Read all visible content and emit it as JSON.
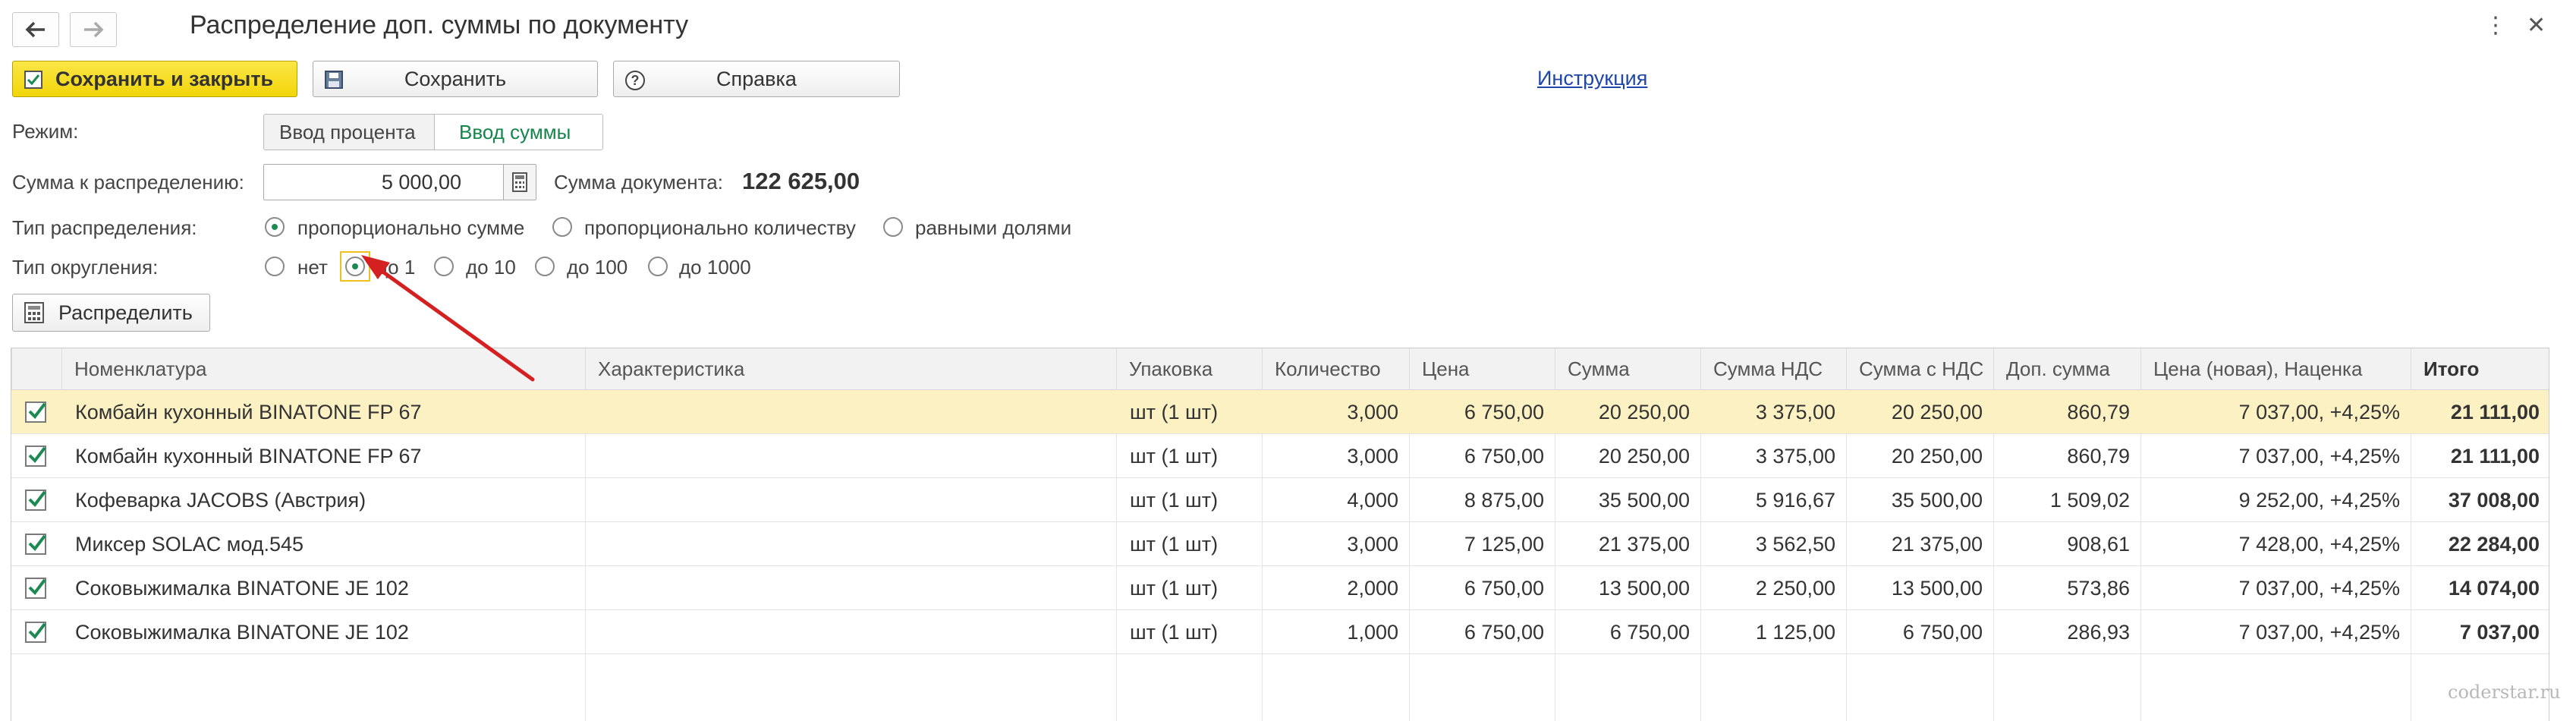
{
  "window": {
    "title": "Распределение доп. суммы по документу",
    "menu_icon": "more-vertical-icon",
    "close_icon": "close-icon"
  },
  "toolbar": {
    "save_close_label": "Сохранить и закрыть",
    "save_label": "Сохранить",
    "help_label": "Справка",
    "instruction_link": "Инструкция"
  },
  "form": {
    "mode_label": "Режим:",
    "mode_options": [
      "Ввод процента",
      "Ввод суммы"
    ],
    "mode_selected": "Ввод суммы",
    "amount_label": "Сумма к распределению:",
    "amount_value": "5 000,00",
    "doc_sum_label": "Сумма документа:",
    "doc_sum_value": "122 625,00",
    "dist_type_label": "Тип распределения:",
    "dist_type_options": [
      "пропорционально сумме",
      "пропорционально количеству",
      "равными долями"
    ],
    "dist_type_selected": "пропорционально сумме",
    "rounding_label": "Тип округления:",
    "rounding_options": [
      "нет",
      "до 1",
      "до 10",
      "до 100",
      "до 1000"
    ],
    "rounding_selected": "до 1",
    "distribute_button": "Распределить"
  },
  "table": {
    "columns": [
      "Номенклатура",
      "Характеристика",
      "Упаковка",
      "Количество",
      "Цена",
      "Сумма",
      "Сумма НДС",
      "Сумма с НДС",
      "Доп. сумма",
      "Цена (новая), Наценка",
      "Итого"
    ],
    "rows": [
      {
        "checked": true,
        "item": "Комбайн кухонный BINATONE FP 67",
        "char": "",
        "pack": "шт (1 шт)",
        "qty": "3,000",
        "price": "6 750,00",
        "sum": "20 250,00",
        "vat": "3 375,00",
        "sum_vat": "20 250,00",
        "add": "860,79",
        "new_price": "7 037,00, +4,25%",
        "total": "21 111,00"
      },
      {
        "checked": true,
        "item": "Комбайн кухонный BINATONE FP 67",
        "char": "",
        "pack": "шт (1 шт)",
        "qty": "3,000",
        "price": "6 750,00",
        "sum": "20 250,00",
        "vat": "3 375,00",
        "sum_vat": "20 250,00",
        "add": "860,79",
        "new_price": "7 037,00, +4,25%",
        "total": "21 111,00"
      },
      {
        "checked": true,
        "item": "Кофеварка JACOBS (Австрия)",
        "char": "",
        "pack": "шт (1 шт)",
        "qty": "4,000",
        "price": "8 875,00",
        "sum": "35 500,00",
        "vat": "5 916,67",
        "sum_vat": "35 500,00",
        "add": "1 509,02",
        "new_price": "9 252,00, +4,25%",
        "total": "37 008,00"
      },
      {
        "checked": true,
        "item": "Миксер SOLAC мод.545",
        "char": "",
        "pack": "шт (1 шт)",
        "qty": "3,000",
        "price": "7 125,00",
        "sum": "21 375,00",
        "vat": "3 562,50",
        "sum_vat": "21 375,00",
        "add": "908,61",
        "new_price": "7 428,00, +4,25%",
        "total": "22 284,00"
      },
      {
        "checked": true,
        "item": "Соковыжималка  BINATONE JE 102",
        "char": "",
        "pack": "шт (1 шт)",
        "qty": "2,000",
        "price": "6 750,00",
        "sum": "13 500,00",
        "vat": "2 250,00",
        "sum_vat": "13 500,00",
        "add": "573,86",
        "new_price": "7 037,00, +4,25%",
        "total": "14 074,00"
      },
      {
        "checked": true,
        "item": "Соковыжималка  BINATONE JE 102",
        "char": "",
        "pack": "шт (1 шт)",
        "qty": "1,000",
        "price": "6 750,00",
        "sum": "6 750,00",
        "vat": "1 125,00",
        "sum_vat": "6 750,00",
        "add": "286,93",
        "new_price": "7 037,00, +4,25%",
        "total": "7 037,00"
      }
    ]
  },
  "watermark": "coderstar.ru",
  "colors": {
    "accent": "#f5d90f",
    "selected_row": "#fcf1c3",
    "radio_on": "#1c8a52",
    "link": "#1e47a8",
    "arrow": "#d42020"
  }
}
